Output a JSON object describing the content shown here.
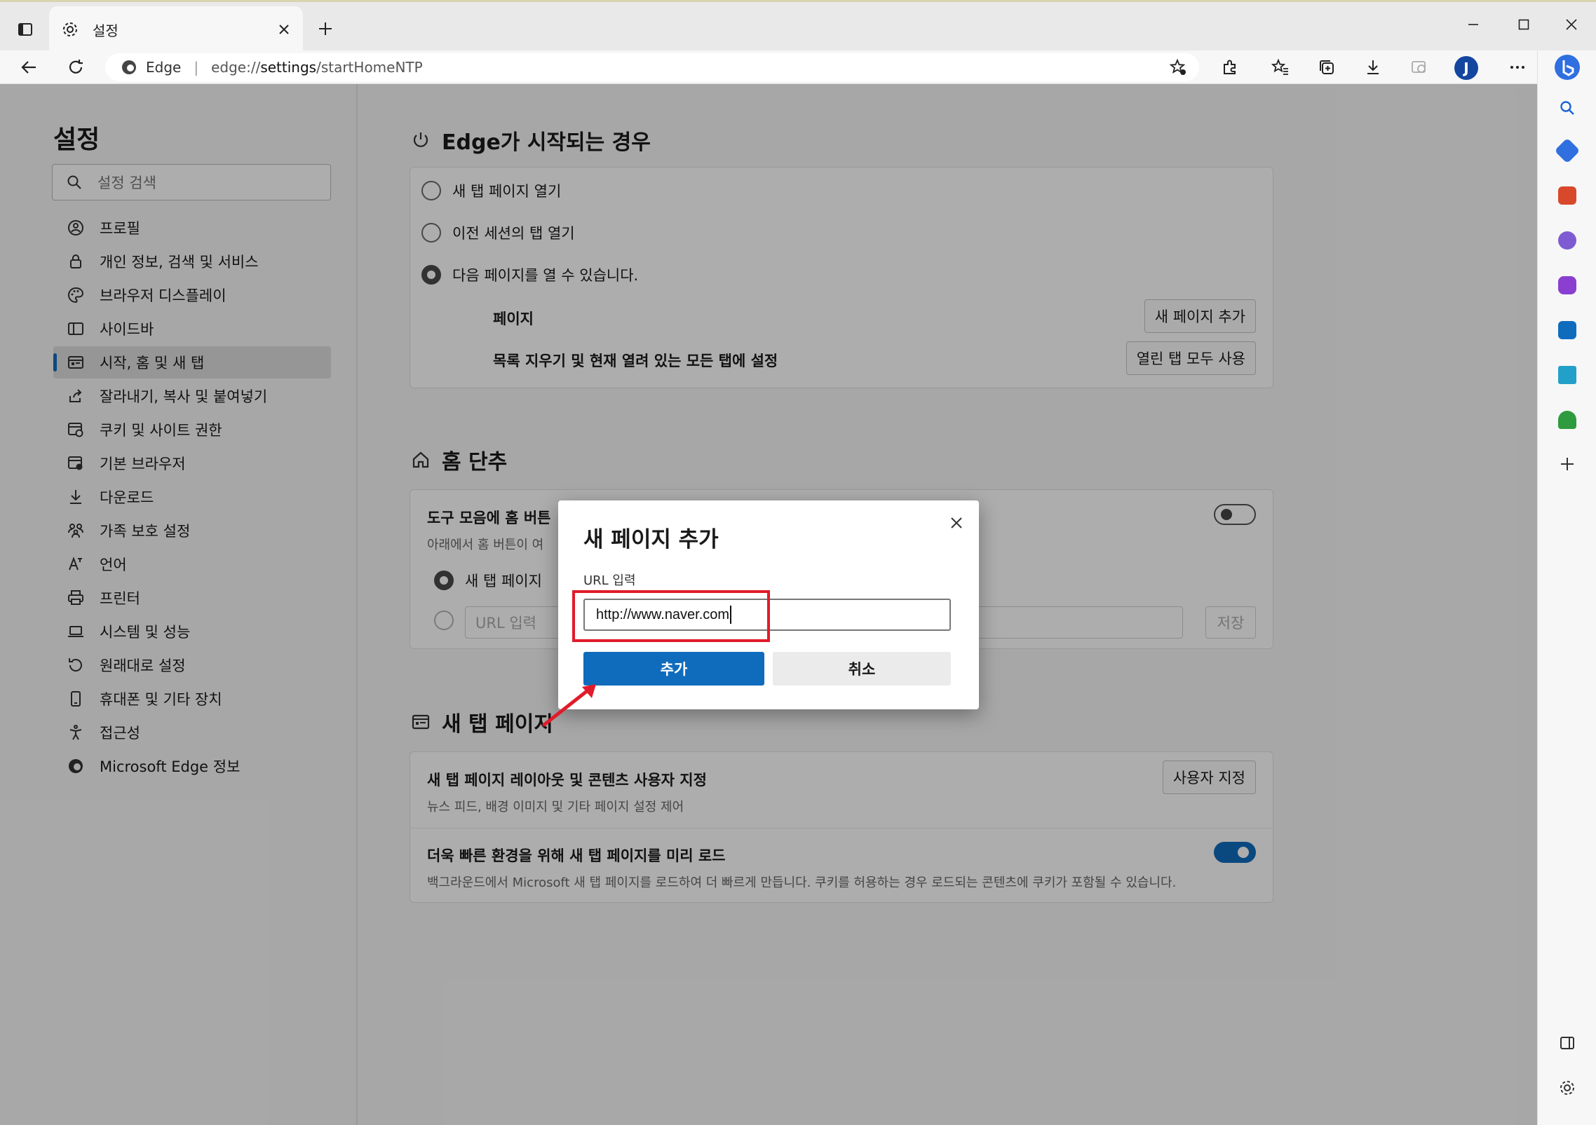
{
  "tab": {
    "title": "설정"
  },
  "toolbar": {
    "site_label": "Edge",
    "url_prefix": "edge://",
    "url_strong": "settings",
    "url_suffix": "/startHomeNTP",
    "avatar_letter": "J"
  },
  "nav": {
    "title": "설정",
    "search_placeholder": "설정 검색",
    "items": [
      {
        "label": "프로필",
        "icon": "profile-icon"
      },
      {
        "label": "개인 정보, 검색 및 서비스",
        "icon": "lock-icon"
      },
      {
        "label": "브라우저 디스플레이",
        "icon": "palette-icon"
      },
      {
        "label": "사이드바",
        "icon": "sidebar-icon"
      },
      {
        "label": "시작, 홈 및 새 탭",
        "icon": "start-home-icon",
        "active": true
      },
      {
        "label": "잘라내기, 복사 및 붙여넣기",
        "icon": "share-icon"
      },
      {
        "label": "쿠키 및 사이트 권한",
        "icon": "cookie-icon"
      },
      {
        "label": "기본 브라우저",
        "icon": "default-browser-icon"
      },
      {
        "label": "다운로드",
        "icon": "download-icon"
      },
      {
        "label": "가족 보호 설정",
        "icon": "family-icon"
      },
      {
        "label": "언어",
        "icon": "language-icon"
      },
      {
        "label": "프린터",
        "icon": "printer-icon"
      },
      {
        "label": "시스템 및 성능",
        "icon": "system-icon"
      },
      {
        "label": "원래대로 설정",
        "icon": "reset-icon"
      },
      {
        "label": "휴대폰 및 기타 장치",
        "icon": "phone-icon"
      },
      {
        "label": "접근성",
        "icon": "accessibility-icon"
      },
      {
        "label": "Microsoft Edge 정보",
        "icon": "edge-logo-icon"
      }
    ]
  },
  "startup": {
    "title": "Edge가 시작되는 경우",
    "option_newtab": "새 탭 페이지 열기",
    "option_prev": "이전 세션의 탭 열기",
    "option_pages": "다음 페이지를 열 수 있습니다.",
    "pages_label": "페이지",
    "add_page_button": "새 페이지 추가",
    "clear_label": "목록 지우기 및 현재 열려 있는 모든 탭에 설정",
    "use_all_tabs_button": "열린 탭 모두 사용"
  },
  "home": {
    "title": "홈 단추",
    "show_label": "도구 모음에 홈 버튼",
    "desc": "아래에서 홈 버튼이 여",
    "option_newtab": "새 탭 페이지",
    "url_placeholder": "URL 입력",
    "save_button": "저장"
  },
  "ntp": {
    "title": "새 탭 페이지",
    "customize_label": "새 탭 페이지 레이아웃 및 콘텐츠 사용자 지정",
    "customize_desc": "뉴스 피드, 배경 이미지 및 기타 페이지 설정 제어",
    "customize_button": "사용자 지정",
    "preload_label": "더욱 빠른 환경을 위해 새 탭 페이지를 미리 로드",
    "preload_desc": "백그라운드에서 Microsoft 새 탭 페이지를 로드하여 더 빠르게 만듭니다. 쿠키를 허용하는 경우 로드되는 콘텐츠에 쿠키가 포함될 수 있습니다."
  },
  "dialog": {
    "title": "새 페이지 추가",
    "url_label": "URL 입력",
    "url_value": "http://www.naver.com",
    "add_button": "추가",
    "cancel_button": "취소"
  },
  "colors": {
    "accent": "#0f6cbd",
    "annotation": "#e11b2b",
    "overlay": "rgba(0,0,0,0.32)"
  }
}
